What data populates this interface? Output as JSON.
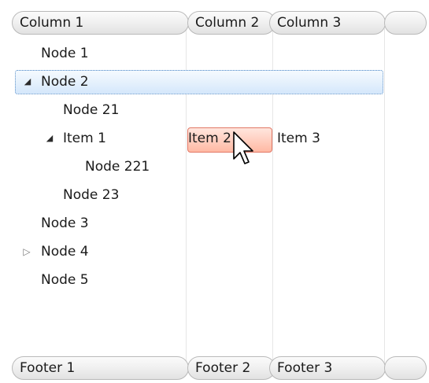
{
  "header": {
    "columns": [
      "Column 1",
      "Column 2",
      "Column 3",
      ""
    ]
  },
  "footer": {
    "cells": [
      "Footer 1",
      "Footer 2",
      "Footer 3",
      ""
    ]
  },
  "rows": [
    {
      "col1": "Node 1",
      "col2": "",
      "col3": ""
    },
    {
      "col1": "Node 2",
      "col2": "",
      "col3": "",
      "expander": "open",
      "selected": true
    },
    {
      "col1": "Node 21",
      "col2": "",
      "col3": ""
    },
    {
      "col1": "Item 1",
      "col2": "Item 2",
      "col3": "Item 3",
      "expander": "open",
      "hover": true
    },
    {
      "col1": "Node 221",
      "col2": "",
      "col3": ""
    },
    {
      "col1": "Node 23",
      "col2": "",
      "col3": ""
    },
    {
      "col1": "Node 3",
      "col2": "",
      "col3": ""
    },
    {
      "col1": "Node 4",
      "col2": "",
      "col3": "",
      "expander": "closed"
    },
    {
      "col1": "Node 5",
      "col2": "",
      "col3": ""
    }
  ],
  "icons": {
    "expanded": "triangle-down-icon",
    "collapsed": "triangle-right-icon",
    "cursor": "mouse-pointer-icon"
  },
  "colors": {
    "selection": "#d4e7fb",
    "selection_border": "#5b8fc7",
    "hover_fill": "#ffcbbb",
    "hover_border": "#e27866",
    "header_border": "#b9b9b9"
  }
}
